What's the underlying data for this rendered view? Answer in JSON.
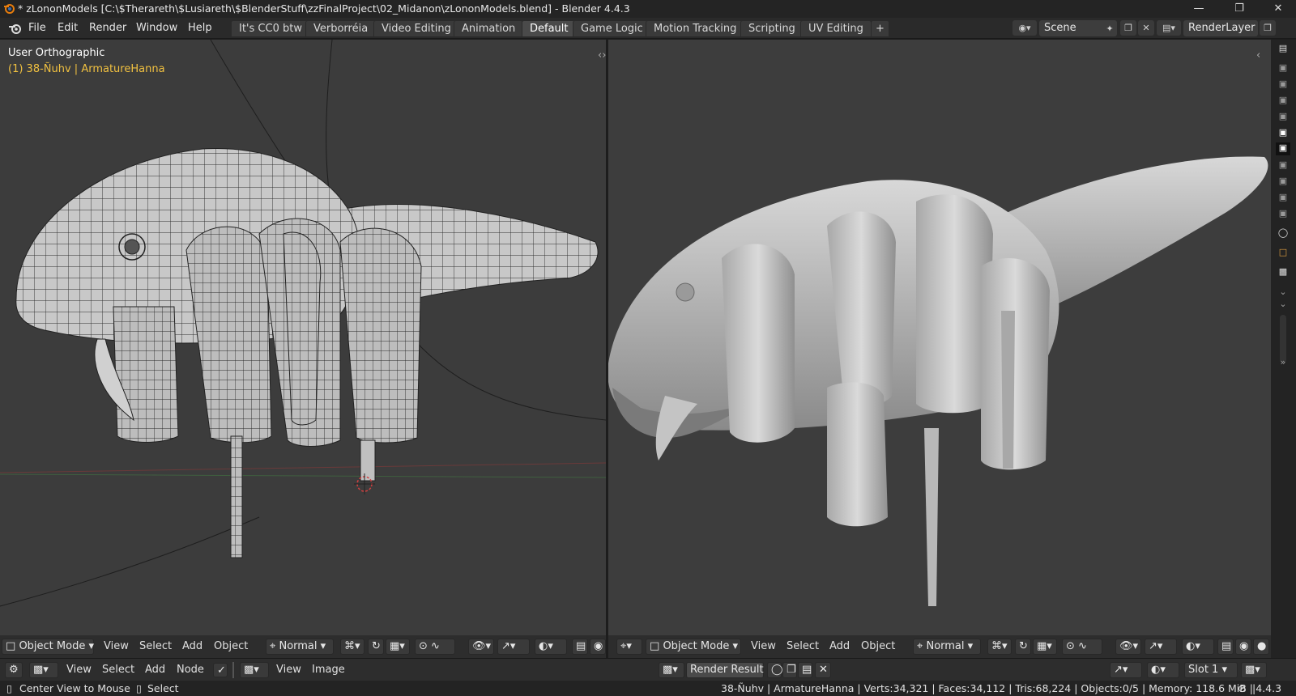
{
  "window": {
    "title": "* zLononModels [C:\\$Therareth\\$Lusiareth\\$BlenderStuff\\zzFinalProject\\02_Midanon\\zLononModels.blend] - Blender 4.4.3"
  },
  "menu": [
    "File",
    "Edit",
    "Render",
    "Window",
    "Help"
  ],
  "workspaces": [
    "It's CC0 btw",
    "Verborréia",
    "Video Editing",
    "Animation",
    "Default",
    "Game Logic",
    "Motion Tracking",
    "Scripting",
    "UV Editing",
    "+"
  ],
  "active_workspace": "Default",
  "scene": {
    "name": "Scene",
    "view_layer": "RenderLayer"
  },
  "viewport_left": {
    "view_label": "User Orthographic",
    "object_info": "(1) 38-Ñuhv | ArmatureHanna",
    "mode": "Object Mode",
    "menus": [
      "View",
      "Select",
      "Add",
      "Object"
    ],
    "orientation": "Normal"
  },
  "viewport_right": {
    "mode": "Object Mode",
    "menus": [
      "View",
      "Select",
      "Add",
      "Object"
    ],
    "orientation": "Normal"
  },
  "node_editor_bar": {
    "menus": [
      "View",
      "Select",
      "Add",
      "Node"
    ],
    "image_menus": [
      "View",
      "Image"
    ],
    "image_name": "Render Result",
    "slot": "Slot 1"
  },
  "status": {
    "left_hint_1": "Center View to Mouse",
    "left_hint_2": "Select",
    "stats": "38-Ñuhv | ArmatureHanna | Verts:34,321 | Faces:34,112 | Tris:68,224 | Objects:0/5 | Memory: 118.6 MiB |",
    "version": "4.4.3"
  },
  "colors": {
    "accent_yellow": "#f0c040",
    "viewport_bg": "#3c3c3c",
    "header_bg": "#2d2d2d"
  }
}
